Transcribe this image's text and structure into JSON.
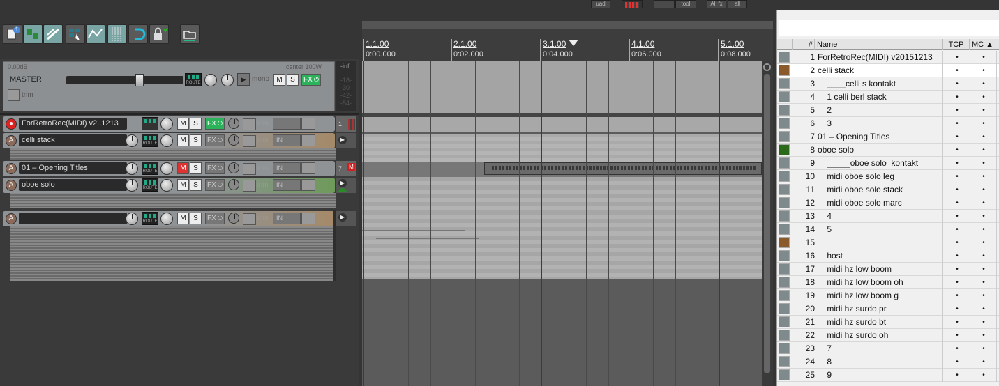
{
  "top_buttons": [
    "uad",
    "",
    "",
    "tool",
    "All fx",
    "all"
  ],
  "toolbar": {
    "icons": [
      "new-project-icon",
      "ripple-icon",
      "link-icon",
      "grid-snap-icon",
      "envelope-icon",
      "grid-lines-icon",
      "loop-icon",
      "lock-icon",
      "folder-icon"
    ],
    "badge": "1"
  },
  "master": {
    "volume_label": "0.00dB",
    "pan_label": "center 100W",
    "name": "MASTER",
    "route": "ROUTE",
    "mono": "mono",
    "m": "M",
    "s": "S",
    "fx": "FX",
    "trim": "trim",
    "meter_labels": [
      "-inf",
      "-18-",
      "-30-",
      "-42-",
      "-54-"
    ]
  },
  "tracks": [
    {
      "name": "ForRetroRec(MIDI) v2..1213",
      "number": "1",
      "arm_icon": "●",
      "fx_on": true,
      "muted": false
    },
    {
      "name": "celli stack",
      "number": "",
      "arm_icon": "A",
      "fx_on": false,
      "muted": false
    },
    {
      "name": "01 – Opening Titles",
      "number": "7",
      "arm_icon": "A",
      "fx_on": false,
      "muted": true,
      "badge": "M"
    },
    {
      "name": "oboe solo",
      "number": "",
      "arm_icon": "A",
      "fx_on": false,
      "muted": false
    },
    {
      "name": "",
      "number": "",
      "arm_icon": "A",
      "fx_on": false,
      "muted": false
    }
  ],
  "track_buttons": {
    "route": "ROUTE",
    "m": "M",
    "s": "S",
    "fx": "FX",
    "trim": "trim",
    "in": "IN"
  },
  "ruler": {
    "bars": [
      "1.1.00",
      "2.1.00",
      "3.1.00",
      "4.1.00",
      "5.1.00"
    ],
    "times": [
      "0:00.000",
      "0:02.000",
      "0:04.000",
      "0:06.000",
      "0:08.000"
    ]
  },
  "track_manager": {
    "headers": {
      "num": "#",
      "name": "Name",
      "tcp": "TCP",
      "mc": "MC ▲"
    },
    "rows": [
      {
        "num": "1",
        "name": "ForRetroRec(MIDI) v20151213",
        "tcp": "•",
        "mc": "•",
        "color": "#7f8a8c"
      },
      {
        "num": "2",
        "name": "celli stack",
        "tcp": "•",
        "mc": "•",
        "color": "#8a5a2a"
      },
      {
        "num": "3",
        "name": "    ____celli s kontakt",
        "tcp": "•",
        "mc": "•",
        "color": "#7f8a8c"
      },
      {
        "num": "4",
        "name": "    1 celli berl stack",
        "tcp": "•",
        "mc": "•",
        "color": "#7f8a8c"
      },
      {
        "num": "5",
        "name": "    2",
        "tcp": "•",
        "mc": "•",
        "color": "#7f8a8c"
      },
      {
        "num": "6",
        "name": "    3",
        "tcp": "•",
        "mc": "•",
        "color": "#7f8a8c"
      },
      {
        "num": "7",
        "name": "01 – Opening Titles",
        "tcp": "•",
        "mc": "•",
        "color": "#7f8a8c"
      },
      {
        "num": "8",
        "name": "oboe solo",
        "tcp": "•",
        "mc": "•",
        "color": "#2a6a1a"
      },
      {
        "num": "9",
        "name": "    _____oboe solo  kontakt",
        "tcp": "•",
        "mc": "•",
        "color": "#7f8a8c"
      },
      {
        "num": "10",
        "name": "    midi oboe solo leg",
        "tcp": "•",
        "mc": "•",
        "color": "#7f8a8c"
      },
      {
        "num": "11",
        "name": "    midi oboe solo stack",
        "tcp": "•",
        "mc": "•",
        "color": "#7f8a8c"
      },
      {
        "num": "12",
        "name": "    midi oboe solo marc",
        "tcp": "•",
        "mc": "•",
        "color": "#7f8a8c"
      },
      {
        "num": "13",
        "name": "    4",
        "tcp": "•",
        "mc": "•",
        "color": "#7f8a8c"
      },
      {
        "num": "14",
        "name": "    5",
        "tcp": "•",
        "mc": "•",
        "color": "#7f8a8c"
      },
      {
        "num": "15",
        "name": "",
        "tcp": "•",
        "mc": "•",
        "color": "#8a5a2a"
      },
      {
        "num": "16",
        "name": "    host",
        "tcp": "•",
        "mc": "•",
        "color": "#7f8a8c"
      },
      {
        "num": "17",
        "name": "    midi hz low boom",
        "tcp": "•",
        "mc": "•",
        "color": "#7f8a8c"
      },
      {
        "num": "18",
        "name": "    midi hz low boom oh",
        "tcp": "•",
        "mc": "•",
        "color": "#7f8a8c"
      },
      {
        "num": "19",
        "name": "    midi hz low boom g",
        "tcp": "•",
        "mc": "•",
        "color": "#7f8a8c"
      },
      {
        "num": "20",
        "name": "    midi hz surdo pr",
        "tcp": "•",
        "mc": "•",
        "color": "#7f8a8c"
      },
      {
        "num": "21",
        "name": "    midi hz surdo bt",
        "tcp": "•",
        "mc": "•",
        "color": "#7f8a8c"
      },
      {
        "num": "22",
        "name": "    midi hz surdo oh",
        "tcp": "•",
        "mc": "•",
        "color": "#7f8a8c"
      },
      {
        "num": "23",
        "name": "    7",
        "tcp": "•",
        "mc": "•",
        "color": "#7f8a8c"
      },
      {
        "num": "24",
        "name": "    8",
        "tcp": "•",
        "mc": "•",
        "color": "#7f8a8c"
      },
      {
        "num": "25",
        "name": "    9",
        "tcp": "•",
        "mc": "•",
        "color": "#7f8a8c"
      }
    ]
  }
}
